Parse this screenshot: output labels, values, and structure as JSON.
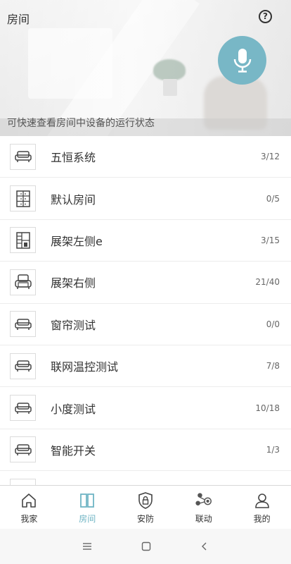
{
  "header": {
    "title": "房间",
    "subtitle": "可快速查看房间中设备的运行状态",
    "help_icon": "help-circle-icon",
    "mic_icon": "microphone-icon",
    "mic_color": "#78b7c6"
  },
  "rooms": [
    {
      "name": "五恒系统",
      "count": "3/12",
      "icon": "sofa-icon"
    },
    {
      "name": "默认房间",
      "count": "0/5",
      "icon": "cabinet-icon"
    },
    {
      "name": "展架左侧e",
      "count": "3/15",
      "icon": "wardrobe-icon"
    },
    {
      "name": "展架右侧",
      "count": "21/40",
      "icon": "armchair-icon"
    },
    {
      "name": "窗帘测试",
      "count": "0/0",
      "icon": "sofa-icon"
    },
    {
      "name": "联网温控测试",
      "count": "7/8",
      "icon": "sofa-icon"
    },
    {
      "name": "小度测试",
      "count": "10/18",
      "icon": "sofa-icon"
    },
    {
      "name": "智能开关",
      "count": "1/3",
      "icon": "sofa-icon"
    }
  ],
  "tabs": [
    {
      "label": "我家",
      "icon": "home-icon",
      "active": false
    },
    {
      "label": "房间",
      "icon": "room-icon",
      "active": true
    },
    {
      "label": "安防",
      "icon": "shield-lock-icon",
      "active": false
    },
    {
      "label": "联动",
      "icon": "linkage-icon",
      "active": false
    },
    {
      "label": "我的",
      "icon": "user-icon",
      "active": false
    }
  ],
  "accent_color": "#6fb4c4",
  "system_nav": [
    "menu-icon",
    "home-square-icon",
    "back-icon"
  ]
}
